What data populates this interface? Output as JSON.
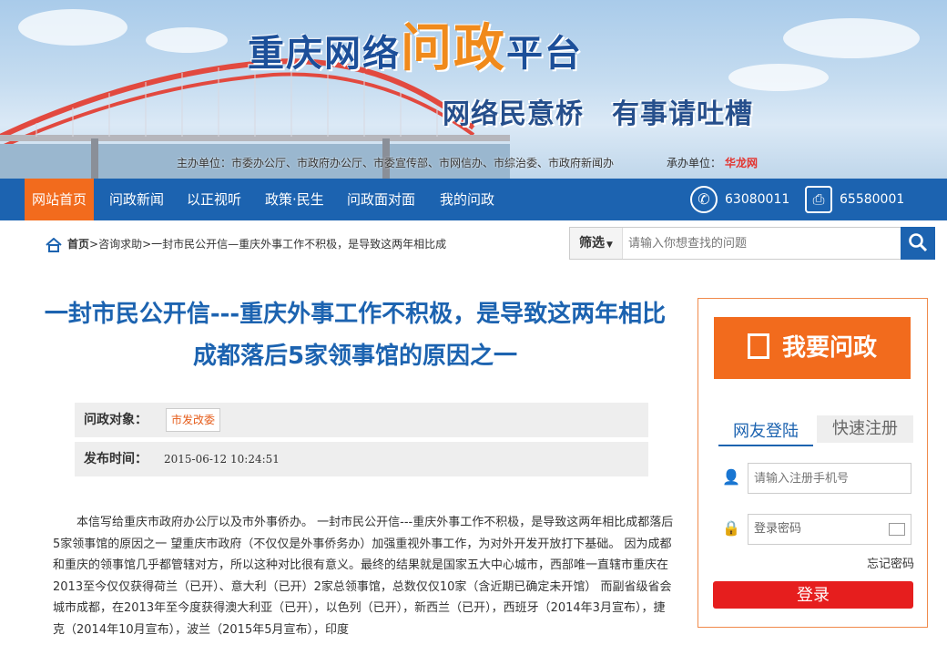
{
  "banner": {
    "title_part1": "重庆网络",
    "title_part2": "问政",
    "title_part3": "平台",
    "slogan": "网络民意桥　有事请吐槽",
    "sponsor": "主办单位：市委办公厅、市政府办公厅、市委宣传部、市网信办、市综治委、市政府新闻办",
    "organizer_label": "承办单位：",
    "organizer_logo": "华龙网"
  },
  "nav": {
    "items": [
      "网站首页",
      "问政新闻",
      "以正视听",
      "政策·民生",
      "问政面对面",
      "我的问政"
    ],
    "phone1": "63080011",
    "phone2": "65580001"
  },
  "breadcrumb": {
    "home": "首页",
    "rest": ">咨询求助>一封市民公开信—重庆外事工作不积极，是导致这两年相比成"
  },
  "search": {
    "filter_label": "筛选",
    "placeholder": "请输入你想查找的问题"
  },
  "article": {
    "title": "一封市民公开信---重庆外事工作不积极，是导致这两年相比成都落后5家领事馆的原因之一",
    "target_label": "问政对象：",
    "target_value": "市发改委",
    "time_label": "发布时间：",
    "time_value": "2015-06-12 10:24:51",
    "body": "本信写给重庆市政府办公厅以及市外事侨办。 一封市民公开信---重庆外事工作不积极，是导致这两年相比成都落后5家领事馆的原因之一 望重庆市政府（不仅仅是外事侨务办）加强重视外事工作，为对外开发开放打下基础。 因为成都和重庆的领事馆几乎都管辖对方，所以这种对比很有意义。最终的结果就是国家五大中心城市，西部唯一直辖市重庆在2013至今仅仅获得荷兰（已开）、意大利（已开）2家总领事馆，总数仅仅10家（含近期已确定未开馆） 而副省级省会城市成都，在2013年至今度获得澳大利亚（已开），以色列（已开），新西兰（已开），西班牙（2014年3月宣布），捷克（2014年10月宣布），波兰（2015年5月宣布），印度"
  },
  "sidebar": {
    "ask_label": "我要问政",
    "tab_login": "网友登陆",
    "tab_register": "快速注册",
    "phone_placeholder": "请输入注册手机号",
    "password_placeholder": "登录密码",
    "forgot": "忘记密码",
    "login_label": "登录"
  },
  "colors": {
    "nav_blue": "#1c63b0",
    "accent_orange": "#f26b1d",
    "login_red": "#e61e1e"
  }
}
